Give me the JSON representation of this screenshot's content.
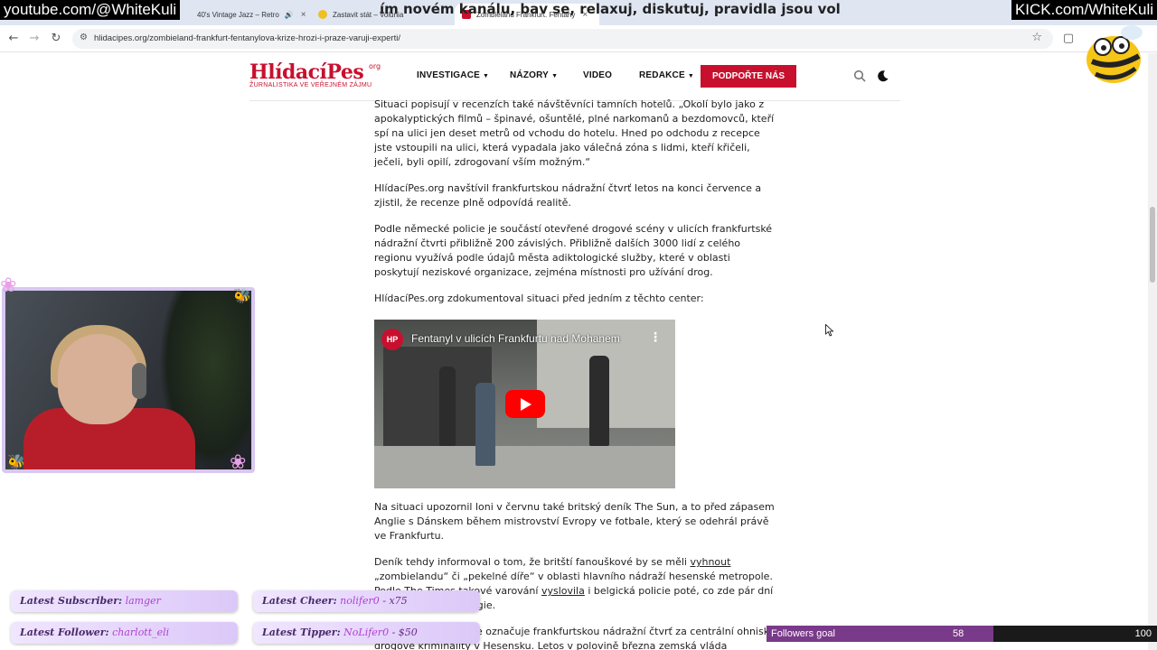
{
  "browser": {
    "tabs": [
      {
        "label": "40's Vintage Jazz – Retro",
        "active": false
      },
      {
        "label": "Zastavit stát – Volunia",
        "active": false
      },
      {
        "label": "Zombieland Frankfurt. Fentany",
        "active": true
      }
    ],
    "url": "hlidacipes.org/zombieland-frankfurt-fentanylova-krize-hrozi-i-praze-varuji-experti/"
  },
  "overlay": {
    "youtube_handle": "youtube.com/@WhiteKuli",
    "kick_handle": "KICK.com/WhiteKuli",
    "marquee": "ím novém kanálu, bav se, relaxuj, diskutuj, pravidla jsou vol"
  },
  "site": {
    "logo": "HlídacíPes",
    "logo_org": "org",
    "logo_tagline": "ŽURNALISTIKA VE VEŘEJNÉM ZÁJMU",
    "nav": [
      {
        "label": "INVESTIGACE",
        "dropdown": true
      },
      {
        "label": "NÁZORY",
        "dropdown": true
      },
      {
        "label": "VIDEO",
        "dropdown": false
      },
      {
        "label": "REDAKCE",
        "dropdown": true
      }
    ],
    "support_button": "PODPOŘTE NÁS",
    "accent": "#c8102e"
  },
  "article": {
    "paragraphs_top": [
      "Situaci popisují v recenzích také návštěvníci tamních hotelů. „Okolí bylo jako z apokalyptických filmů – špinavé, ošuntělé, plné narkomanů a bezdomovců, kteří spí na ulici jen deset metrů od vchodu do hotelu. Hned po odchodu z recepce jste vstoupili na ulici, která vypadala jako válečná zóna s lidmi, kteří křičeli, ječeli, byli opilí, zdrogovaní vším možným.“",
      "HlídacíPes.org navštívil frankfurtskou nádražní čtvrť letos na konci července a zjistil, že recenze plně odpovídá realitě.",
      "Podle německé policie je součástí otevřené drogové scény v ulicích frankfurtské nádražní čtvrti přibližně 200 závislých. Přibližně dalších 3000 lidí z celého regionu využívá podle údajů města adiktologické služby, které v oblasti poskytují neziskové organizace, zejména místnosti pro užívání drog.",
      "HlídacíPes.org zdokumentoval situaci před jedním z těchto center:"
    ],
    "video_title": "Fentanyl v ulicích Frankfurtu nad Mohanem",
    "video_logo": "HP",
    "p5": "Na situaci upozornil loni v červnu také britský deník The Sun, a to před zápasem Anglie s Dánskem během mistrovství Evropy ve fotbale, který se odehrál právě ve Frankfurtu.",
    "p6_a": "Deník tehdy informoval o tom, že britští fanouškové by se měli ",
    "p6_link1": "vyhnout",
    "p6_b": " „zombielandu“ či „pekelné díře“ v oblasti hlavního nádraží hesenské metropole.  Podle The Times takové varování ",
    "p6_link2": "vyslovila",
    "p6_c": " i belgická policie poté, co zde pár dní předtím hrál tým Belgie.",
    "p7": "Zpráva Evropské unie označuje frankfurtskou nádražní čtvrť za centrální ohnisko drogové kriminality v Hesensku. Letos v polovině března zemská vláda oznámila, že má v úmyslu"
  },
  "alerts": {
    "subscriber_label": "Latest Subscriber:",
    "subscriber": "lamger",
    "cheer_label": "Latest Cheer:",
    "cheer": "nolifer0",
    "cheer_amount": " - x75",
    "follower_label": "Latest Follower:",
    "follower": "charlott_eli",
    "tipper_label": "Latest Tipper:",
    "tipper": "NoLifer0",
    "tipper_amount": " - $50"
  },
  "followers_goal": {
    "label": "Followers goal",
    "current": "58",
    "target": "100",
    "progress": 0.58
  }
}
